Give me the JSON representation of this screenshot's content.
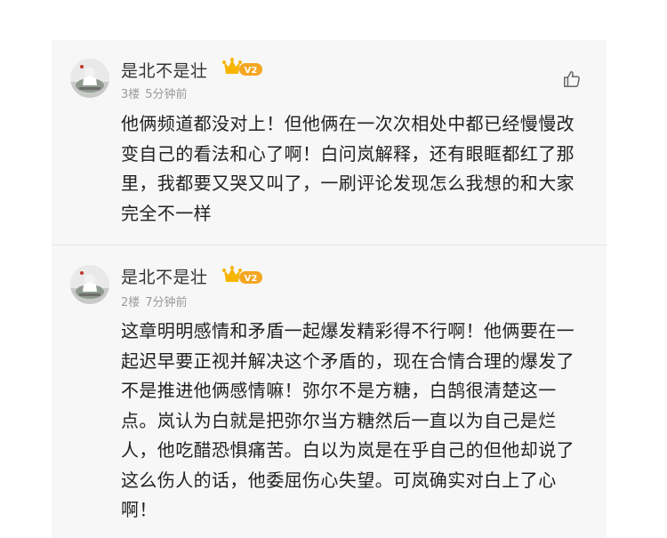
{
  "comments": [
    {
      "username": "是北不是壮",
      "level_badge": "V2",
      "floor": "3楼",
      "time": "5分钟前",
      "like_icon": "thumbs-up-icon",
      "text": "他俩频道都没对上！但他俩在一次次相处中都已经慢慢改变自己的看法和心了啊！白问岚解释，还有眼眶都红了那里，我都要又哭又叫了，一刷评论发现怎么我想的和大家完全不一样"
    },
    {
      "username": "是北不是壮",
      "level_badge": "V2",
      "floor": "2楼",
      "time": "7分钟前",
      "text": "这章明明感情和矛盾一起爆发精彩得不行啊！他俩要在一起迟早要正视并解决这个矛盾的，现在合情合理的爆发了不是推进他俩感情嘛！弥尔不是方糖，白鹄很清楚这一点。岚认为白就是把弥尔当方糖然后一直以为自己是烂人，他吃醋恐惧痛苦。白以为岚是在乎自己的但他却说了这么伤人的话，他委屈伤心失望。可岚确实对白上了心啊！"
    }
  ],
  "colors": {
    "panel_bg": "#f7f7f7",
    "badge_orange": "#f5a623",
    "crown_gold": "#f7b500"
  }
}
